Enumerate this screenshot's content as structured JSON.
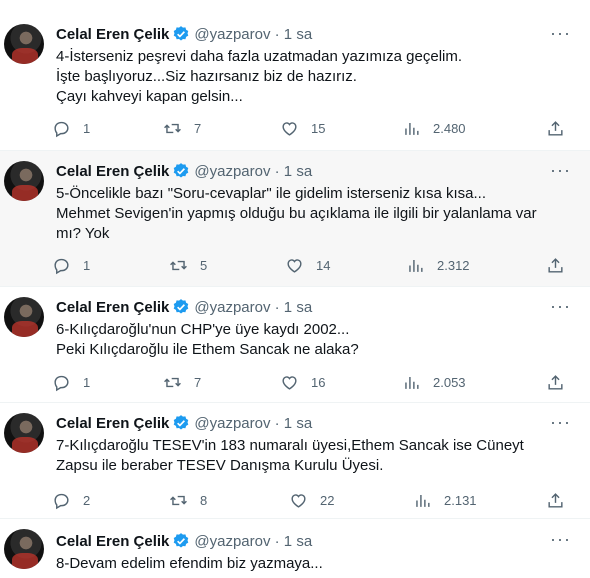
{
  "author": {
    "name": "Celal Eren Çelik",
    "handle": "@yazparov · 1 sa"
  },
  "tweets": [
    {
      "lines": [
        "4-İsterseniz peşrevi daha fazla uzatmadan yazımıza geçelim.",
        "İşte başlıyoruz...Siz hazırsanız biz de hazırız.",
        "Çayı kahveyi kapan gelsin..."
      ],
      "replies": "1",
      "retweets": "7",
      "likes": "15",
      "views": "2.480"
    },
    {
      "lines": [
        "5-Öncelikle bazı \"Soru-cevaplar\" ile gidelim isterseniz kısa kısa...",
        "Mehmet Sevigen'in yapmış olduğu bu açıklama ile ilgili bir yalanlama var",
        "mı? Yok"
      ],
      "replies": "1",
      "retweets": "5",
      "likes": "14",
      "views": "2.312"
    },
    {
      "lines": [
        "6-Kılıçdaroğlu'nun CHP'ye üye kaydı 2002...",
        "Peki Kılıçdaroğlu ile Ethem Sancak ne alaka?"
      ],
      "replies": "1",
      "retweets": "7",
      "likes": "16",
      "views": "2.053"
    },
    {
      "lines": [
        "7-Kılıçdaroğlu TESEV'in 183 numaralı üyesi,Ethem Sancak ise Cüneyt",
        "Zapsu ile beraber TESEV Danışma Kurulu Üyesi."
      ],
      "replies": "2",
      "retweets": "8",
      "likes": "22",
      "views": "2.131"
    },
    {
      "lines": [
        "8-Devam edelim efendim biz yazmaya..."
      ]
    }
  ],
  "icons": {
    "more": "more-horizontal-icon",
    "verified": "verified-badge-icon",
    "reply": "reply-icon",
    "retweet": "retweet-icon",
    "like": "heart-icon",
    "views": "views-icon",
    "share": "share-icon"
  },
  "colors": {
    "verified": "#1d9bf0",
    "secondary_text": "#536471",
    "highlight_bg": "#f7f7f7"
  }
}
